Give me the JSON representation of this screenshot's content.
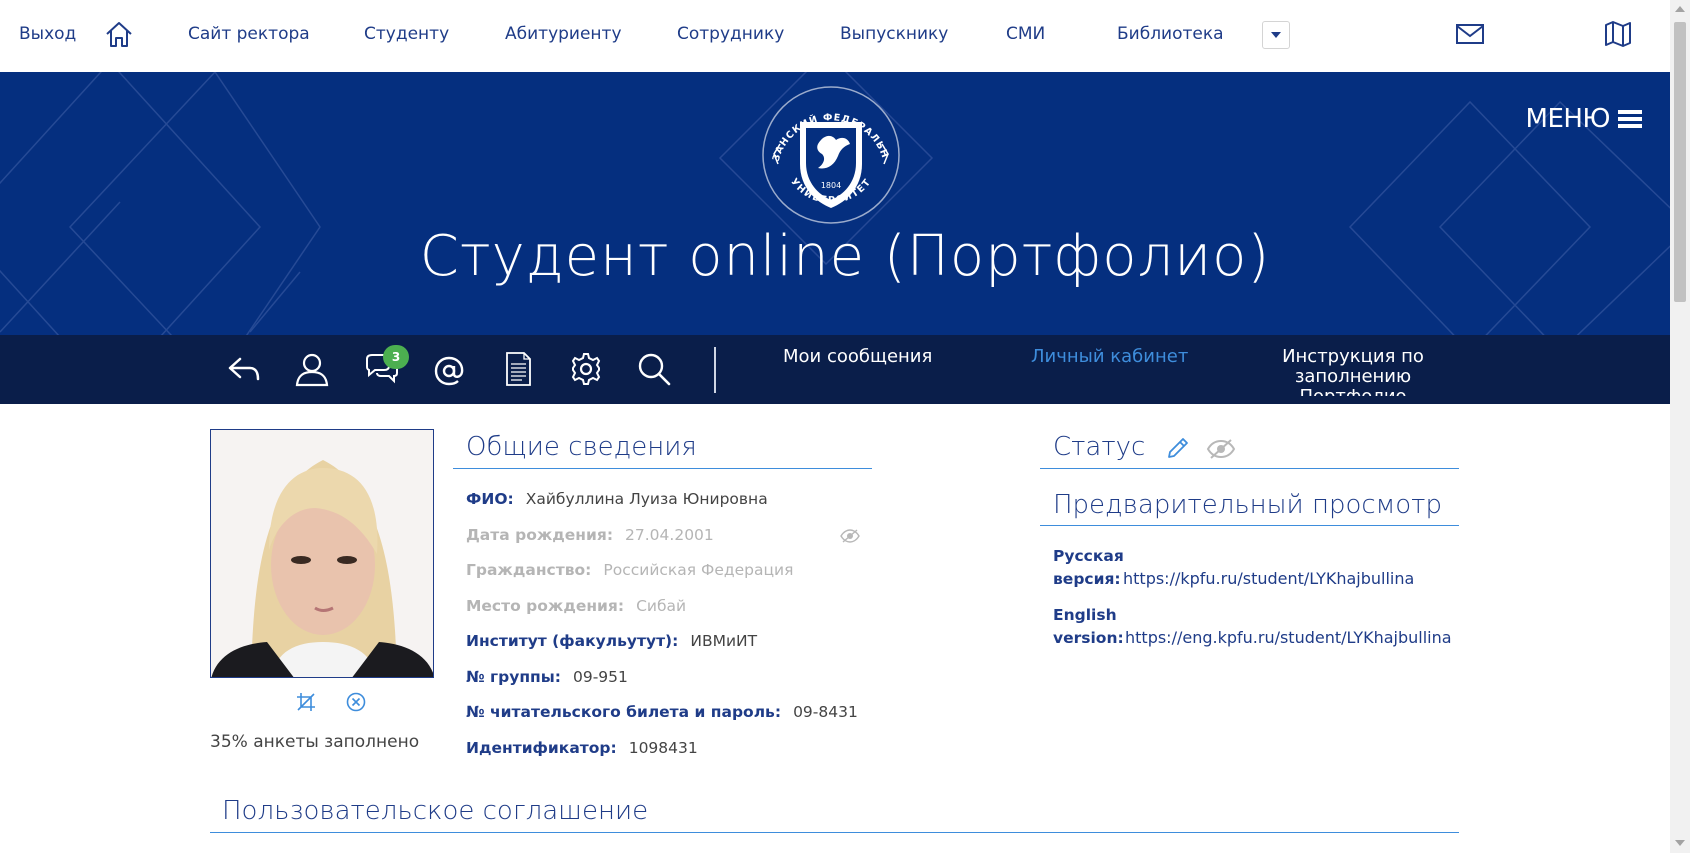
{
  "topnav": {
    "logout": "Выход",
    "items": [
      "Сайт ректора",
      "Студенту",
      "Абитуриенту",
      "Сотруднику",
      "Выпускнику",
      "СМИ",
      "Библиотека"
    ],
    "icons": [
      "home-icon",
      "chevron-down-icon",
      "mail-icon",
      "map-icon"
    ]
  },
  "banner": {
    "title": "Студент online (Портфолио)",
    "menu_label": "МЕНЮ",
    "emblem_text_top": "КАЗАНСКИЙ ФЕДЕРАЛЬНЫЙ",
    "emblem_text_bottom": "УНИВЕРСИТЕТ",
    "emblem_year": "1804",
    "colors": {
      "background": "#052f7f",
      "text": "#ffffff"
    }
  },
  "toolbar": {
    "icons": [
      "back-arrow-icon",
      "user-icon",
      "messages-icon",
      "at-icon",
      "document-icon",
      "gear-icon",
      "search-icon"
    ],
    "messages_badge": "3",
    "links": {
      "messages": "Мои сообщения",
      "cabinet": "Личный кабинет",
      "instruction": "Инструкция по заполнению Портфолио"
    },
    "colors": {
      "background": "#0a1e4a",
      "active_link": "#3e8ddc",
      "badge": "#4caf50"
    }
  },
  "profile": {
    "fill_status": "35% анкеты заполнено"
  },
  "general": {
    "title": "Общие сведения",
    "rows": [
      {
        "label": "ФИО:",
        "value": "Хайбуллина Луиза Юнировна"
      },
      {
        "label": "Дата рождения:",
        "value": "27.04.2001"
      },
      {
        "label": "Гражданство:",
        "value": "Российская Федерация"
      },
      {
        "label": "Место рождения:",
        "value": "Сибай"
      },
      {
        "label": "Институт (факульутут):",
        "value": "ИВМиИТ"
      },
      {
        "label": "№ группы:",
        "value": "09-951"
      },
      {
        "label": "№ читательского билета и пароль:",
        "value": "09-8431"
      },
      {
        "label": "Идентификатор:",
        "value": "1098431"
      }
    ]
  },
  "status": {
    "title": "Статус"
  },
  "preview": {
    "title": "Предварительный просмотр",
    "ru_label_1": "Русская",
    "ru_label_2": "версия:",
    "ru_url": "https://kpfu.ru/student/LYKhajbullina",
    "en_label_1": "English",
    "en_label_2": "version:",
    "en_url": "https://eng.kpfu.ru/student/LYKhajbullina"
  },
  "agreement": {
    "title": "Пользовательское соглашение"
  },
  "accent_color": "#1f3c88",
  "link_color": "#3e8ddc"
}
